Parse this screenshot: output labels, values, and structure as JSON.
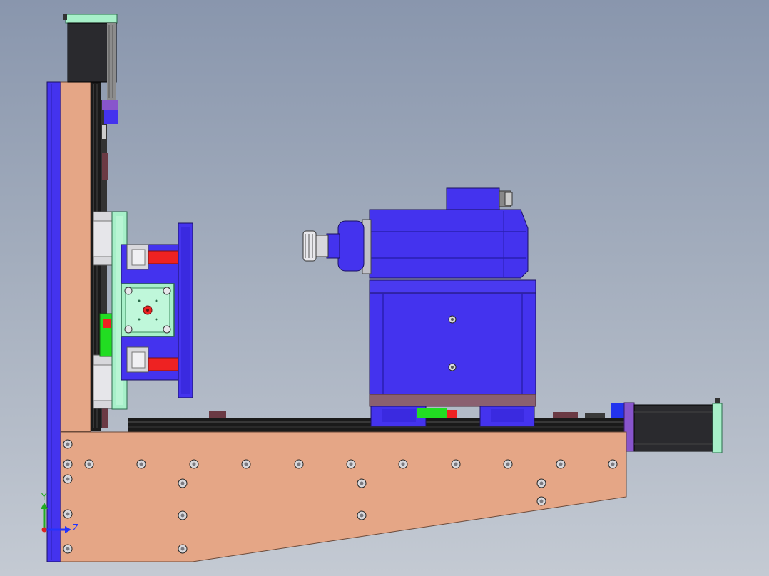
{
  "viewport": {
    "colors": {
      "background_top": "#8996ad",
      "background_bottom": "#c4cad3",
      "copper": "#e5a686",
      "blue": "#4433ee",
      "dark_blue": "#2a1fb0",
      "mint": "#a7f0c9",
      "green": "#22dd22",
      "red": "#ee2222",
      "motor_black": "#2a2a2e",
      "rail": "#1a1a1a",
      "gray": "#d8d8dc",
      "maroon": "#6b3a44",
      "purple": "#8855cc"
    }
  },
  "triad": {
    "y_label": "Y",
    "z_label": "Z",
    "y_color": "#22aa22",
    "z_color": "#2233ff",
    "origin_color": "#dd2222"
  }
}
